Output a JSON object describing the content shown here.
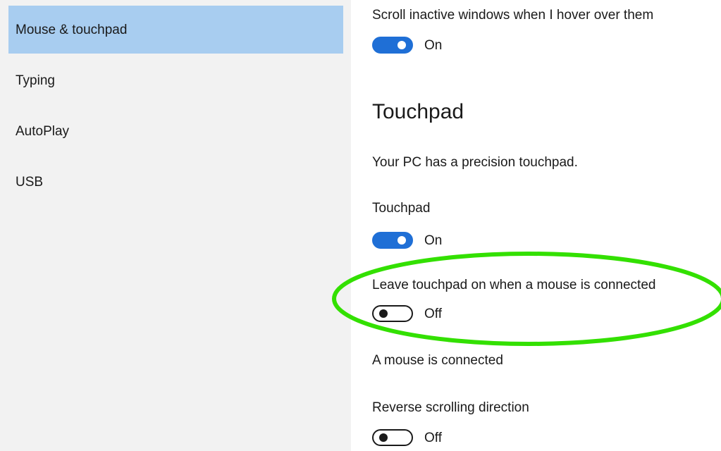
{
  "sidebar": {
    "items": [
      {
        "label": "Mouse & touchpad",
        "selected": true
      },
      {
        "label": "Typing",
        "selected": false
      },
      {
        "label": "AutoPlay",
        "selected": false
      },
      {
        "label": "USB",
        "selected": false
      }
    ]
  },
  "main": {
    "scroll_inactive": {
      "label": "Scroll inactive windows when I hover over them",
      "state_label": "On",
      "on": true
    },
    "touchpad_section": {
      "heading": "Touchpad",
      "description": "Your PC has a precision touchpad."
    },
    "touchpad_toggle": {
      "label": "Touchpad",
      "state_label": "On",
      "on": true
    },
    "leave_touchpad_on": {
      "label": "Leave touchpad on when a mouse is connected",
      "state_label": "Off",
      "on": false
    },
    "mouse_status": "A mouse is connected",
    "reverse_scrolling": {
      "label": "Reverse scrolling direction",
      "state_label": "Off",
      "on": false
    }
  },
  "colors": {
    "accent": "#1f6fd6",
    "selected_nav": "#a8cdf0",
    "sidebar_bg": "#f2f2f2",
    "highlight_ring": "#33e000"
  }
}
